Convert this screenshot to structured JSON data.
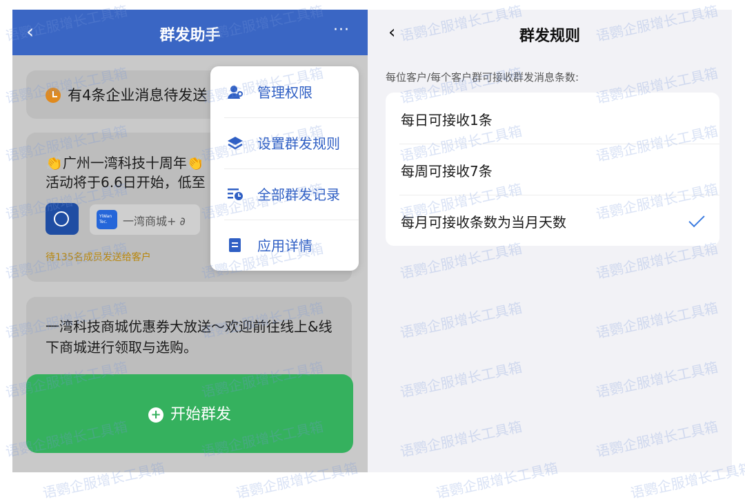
{
  "left": {
    "header": {
      "back_icon": "‹",
      "title": "群发助手",
      "more_icon": "···"
    },
    "card1": {
      "text": "有4条企业消息待发送"
    },
    "card2": {
      "text": "👏广州一湾科技十周年👏 活动将于6.6日开始，低至",
      "chip_logo": "YiWan Tec.",
      "chip_name": "一湾商城+ ∂",
      "status": "待135名成员发送给客户"
    },
    "card3": {
      "text": "一湾科技商城优惠券大放送～欢迎前往线上&线下商城进行领取与选购。"
    },
    "cta": {
      "label": "开始群发",
      "icon": "plus-circle-icon"
    },
    "menu": {
      "items": [
        {
          "label": "管理权限",
          "icon": "user-gear-icon"
        },
        {
          "label": "设置群发规则",
          "icon": "layers-icon"
        },
        {
          "label": "全部群发记录",
          "icon": "list-clock-icon"
        },
        {
          "label": "应用详情",
          "icon": "doc-icon"
        }
      ]
    }
  },
  "right": {
    "header": {
      "back_icon": "‹",
      "title": "群发规则"
    },
    "section_label": "每位客户/每个客户群可接收群发消息条数:",
    "options": [
      {
        "label": "每日可接收1条",
        "selected": false
      },
      {
        "label": "每周可接收7条",
        "selected": false
      },
      {
        "label": "每月可接收条数为当月天数",
        "selected": true
      }
    ]
  },
  "watermark": "语鹦企服增长工具箱",
  "colors": {
    "header": "#3a66c4",
    "accent": "#2f5fc4",
    "cta": "#35b15e",
    "check": "#3a7be0"
  }
}
